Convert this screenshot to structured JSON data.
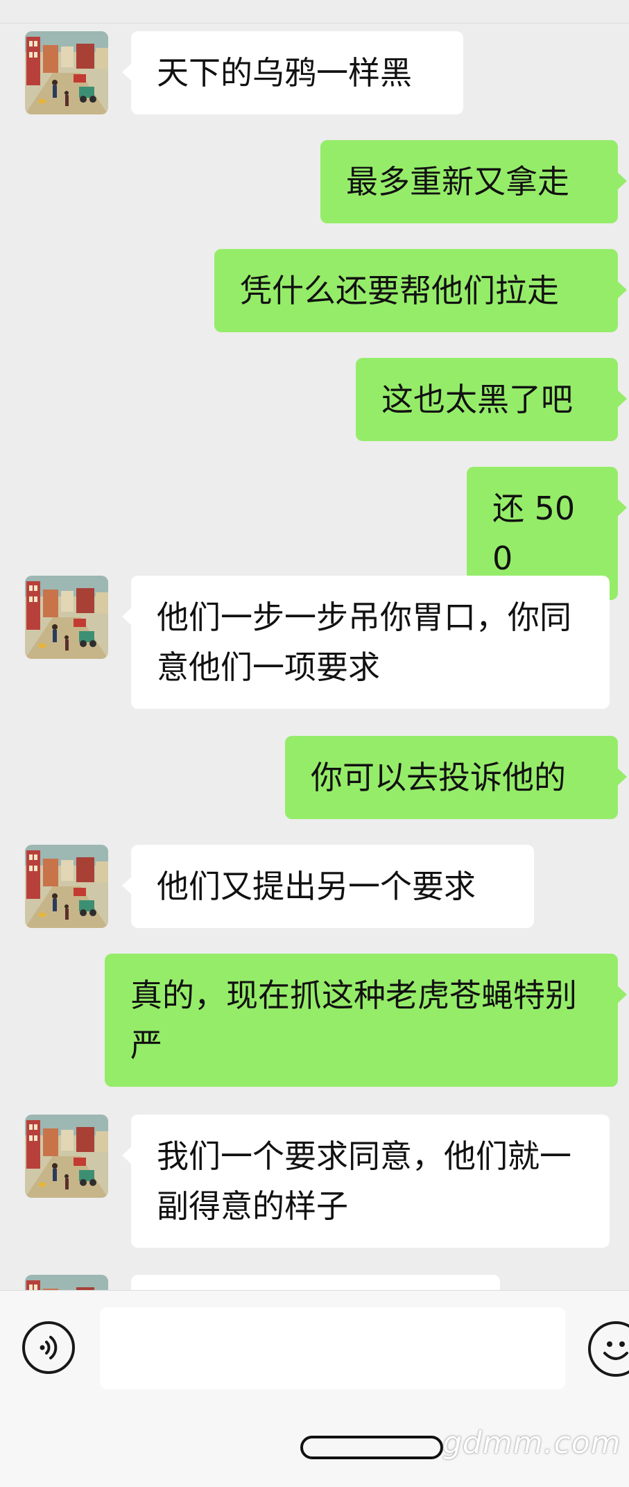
{
  "messages": [
    {
      "side": "in",
      "text": "天下的乌鸦一样黑"
    },
    {
      "side": "out",
      "text": "最多重新又拿走"
    },
    {
      "side": "out",
      "text": "凭什么还要帮他们拉走"
    },
    {
      "side": "out",
      "text": "这也太黑了吧"
    },
    {
      "side": "out",
      "text": "还 500"
    },
    {
      "side": "in",
      "text": "他们一步一步吊你胃口，你同意他们一项要求"
    },
    {
      "side": "out",
      "text": "你可以去投诉他的"
    },
    {
      "side": "in",
      "text": "他们又提出另一个要求"
    },
    {
      "side": "out",
      "text": "真的，现在抓这种老虎苍蝇特别严"
    },
    {
      "side": "in",
      "text": "我们一个要求同意，他们就一副得意的样子"
    },
    {
      "side": "in",
      "text": ""
    }
  ],
  "icons": {
    "voice": "voice-input-icon",
    "emoji": "emoji-icon",
    "avatar": "contact-avatar"
  },
  "colors": {
    "outgoing_bubble": "#95ec69",
    "incoming_bubble": "#ffffff",
    "background": "#ededed"
  },
  "watermark": "gdmm.com"
}
